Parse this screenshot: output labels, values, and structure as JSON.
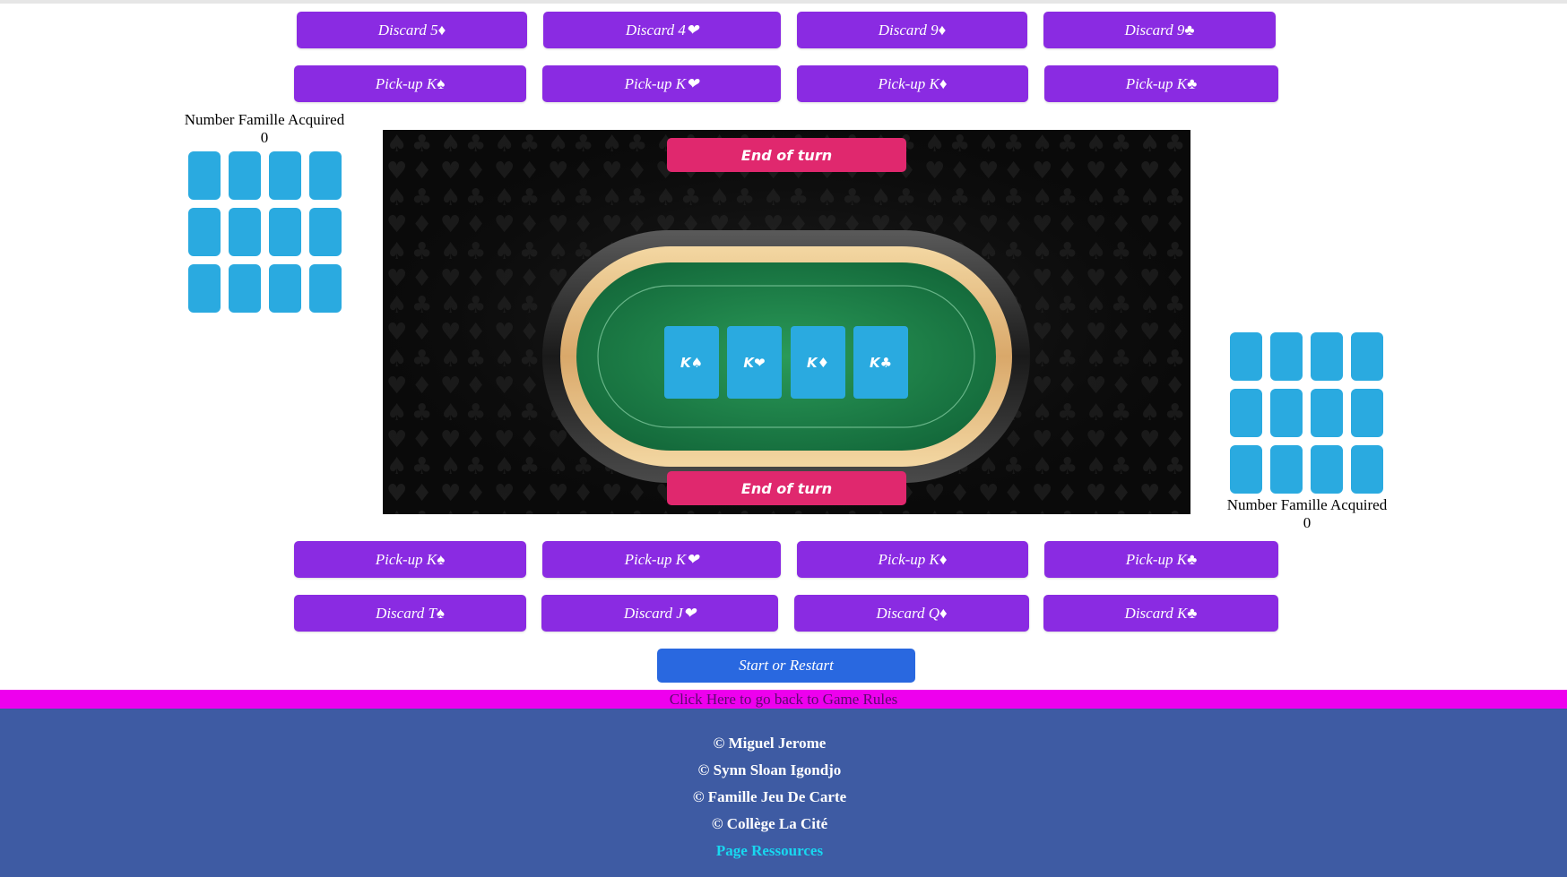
{
  "top_player": {
    "discard_buttons": [
      "Discard 5♦",
      "Discard 4❤",
      "Discard 9♦",
      "Discard 9♣"
    ],
    "pickup_buttons": [
      "Pick-up K♠",
      "Pick-up K❤",
      "Pick-up K♦",
      "Pick-up K♣"
    ],
    "famille_label": "Number Famille Acquired",
    "famille_count": "0",
    "hand_card_count": 12
  },
  "bottom_player": {
    "pickup_buttons": [
      "Pick-up K♠",
      "Pick-up K❤",
      "Pick-up K♦",
      "Pick-up K♣"
    ],
    "discard_buttons": [
      "Discard T♠",
      "Discard J❤",
      "Discard Q♦",
      "Discard K♣"
    ],
    "famille_label": "Number Famille Acquired",
    "famille_count": "0",
    "hand_card_count": 12
  },
  "table": {
    "end_turn_top": "End of turn",
    "end_turn_bottom": "End of turn",
    "center_cards": [
      "K♠",
      "K❤",
      "K♦",
      "K♣"
    ]
  },
  "start_button": "Start or Restart",
  "rules_link": "Click Here to go back to Game Rules",
  "footer": {
    "credits": [
      "© Miguel Jerome",
      "© Synn Sloan Igondjo",
      "© Famille Jeu De Carte",
      "© Collège La Cité"
    ],
    "resources_link": "Page Ressources"
  },
  "colors": {
    "button_purple": "#8a2be2",
    "card_blue": "#2aaae0",
    "end_turn_pink": "#e0286e",
    "start_blue": "#2968e0",
    "rules_magenta": "#ee00ee",
    "footer_blue": "#3e5ba3",
    "felt_green": "#1f8a4c"
  }
}
